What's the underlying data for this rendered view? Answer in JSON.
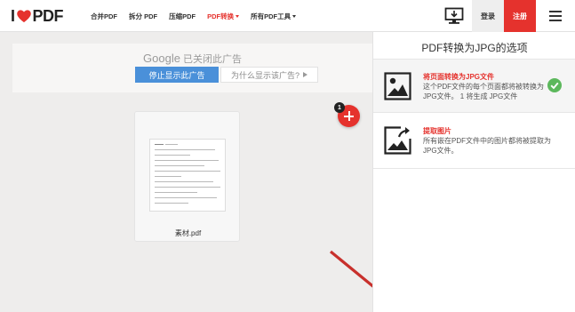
{
  "header": {
    "logo_left": "I",
    "logo_right": "PDF",
    "nav": [
      {
        "label": "合并PDF",
        "active": false,
        "caret": false
      },
      {
        "label": "拆分 PDF",
        "active": false,
        "caret": false
      },
      {
        "label": "压缩PDF",
        "active": false,
        "caret": false
      },
      {
        "label": "PDF转换",
        "active": true,
        "caret": true
      },
      {
        "label": "所有PDF工具",
        "active": false,
        "caret": true
      }
    ],
    "login_label": "登录",
    "register_label": "注册"
  },
  "ad": {
    "google_label": "Google",
    "closed_text": "已关闭此广告",
    "stop_label": "停止显示此广告",
    "why_label": "为什么显示该广告?"
  },
  "file": {
    "name": "素材.pdf"
  },
  "add_button": {
    "badge": "1"
  },
  "panel": {
    "title": "PDF转换为JPG的选项",
    "options": [
      {
        "title": "将页面转换为JPG文件",
        "description": "这个PDF文件的每个页面都将被转换为JPG文件。 1 将生成 JPG文件",
        "selected": true
      },
      {
        "title": "提取图片",
        "description": "所有嵌在PDF文件中的图片都将被提取为JPG文件。",
        "selected": false
      }
    ]
  },
  "colors": {
    "brand_red": "#e5322d",
    "ad_blue": "#4a90d9",
    "check_green": "#5cb85c"
  }
}
